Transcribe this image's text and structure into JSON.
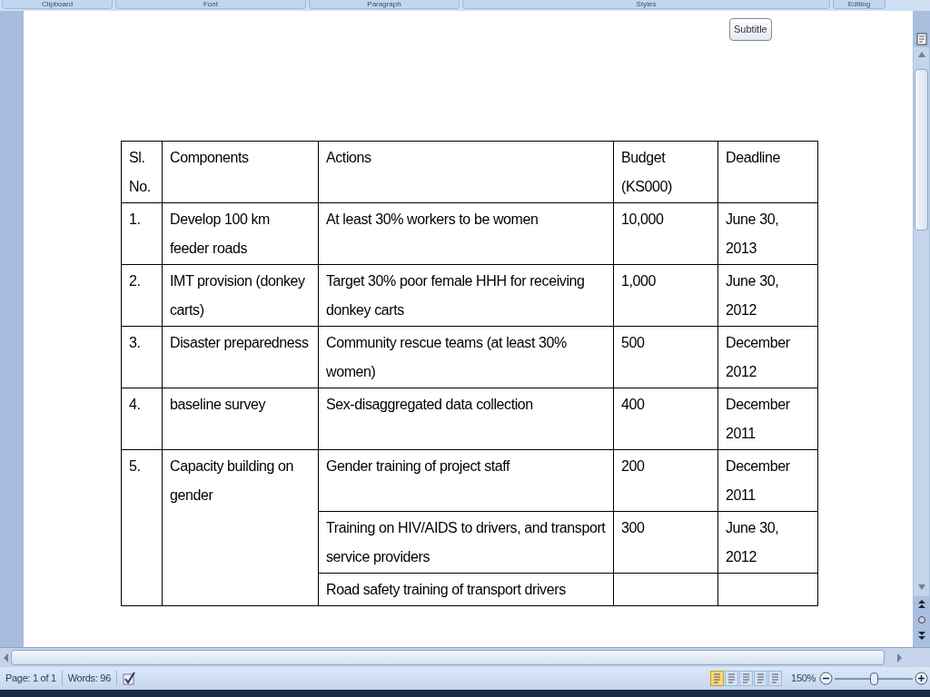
{
  "ribbon_groups": [
    {
      "label": "Clipboard"
    },
    {
      "label": "Font"
    },
    {
      "label": "Paragraph"
    },
    {
      "label": "Styles"
    },
    {
      "label": "Editing"
    }
  ],
  "tooltip": "Subtitle",
  "table": {
    "columns": [
      "Sl. No.",
      "Components",
      "Actions",
      "Budget (KS000)",
      "Deadline"
    ],
    "rows": [
      {
        "sl": "1.",
        "component": "Develop 100 km feeder roads",
        "actions": [
          {
            "action": "At least 30% workers to be women",
            "budget": "10,000",
            "deadline": "June 30, 2013"
          }
        ]
      },
      {
        "sl": "2.",
        "component": "IMT provision (donkey carts)",
        "actions": [
          {
            "action": "Target 30% poor female HHH for receiving donkey carts",
            "budget": "1,000",
            "deadline": "June 30, 2012"
          }
        ]
      },
      {
        "sl": "3.",
        "component": "Disaster preparedness",
        "actions": [
          {
            "action": "Community rescue teams (at least 30% women)",
            "budget": "500",
            "deadline": "December 2012"
          }
        ]
      },
      {
        "sl": "4.",
        "component": "baseline survey",
        "actions": [
          {
            "action": "Sex-disaggregated data collection",
            "budget": "400",
            "deadline": "December 2011"
          }
        ]
      },
      {
        "sl": "5.",
        "component": "Capacity building on gender",
        "actions": [
          {
            "action": "Gender training of project staff",
            "budget": "200",
            "deadline": "December 2011"
          },
          {
            "action": "Training on HIV/AIDS to drivers, and transport service providers",
            "budget": "300",
            "deadline": "June 30, 2012"
          },
          {
            "action": "Road safety training of transport drivers"
          }
        ]
      }
    ]
  },
  "status_bar": {
    "page": "Page: 1 of 1",
    "words": "Words: 96",
    "views": [
      {
        "selected": true
      },
      {
        "selected": false
      },
      {
        "selected": false
      },
      {
        "selected": false
      },
      {
        "selected": false
      }
    ],
    "zoom": "150%",
    "zoom_slider": {
      "level": 0.5
    }
  }
}
